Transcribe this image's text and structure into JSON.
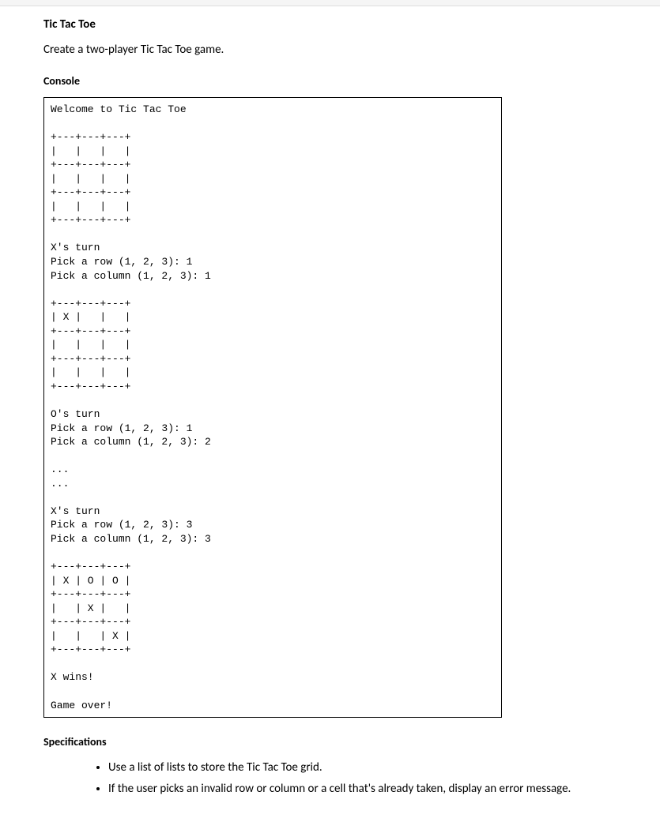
{
  "title": "Tic Tac Toe",
  "description": "Create a two-player Tic Tac Toe game.",
  "console_heading": "Console",
  "console_output": "Welcome to Tic Tac Toe\n\n+---+---+---+\n|   |   |   |\n+---+---+---+\n|   |   |   |\n+---+---+---+\n|   |   |   |\n+---+---+---+\n\nX's turn\nPick a row (1, 2, 3): 1\nPick a column (1, 2, 3): 1\n\n+---+---+---+\n| X |   |   |\n+---+---+---+\n|   |   |   |\n+---+---+---+\n|   |   |   |\n+---+---+---+\n\nO's turn\nPick a row (1, 2, 3): 1\nPick a column (1, 2, 3): 2\n\n...\n...\n\nX's turn\nPick a row (1, 2, 3): 3\nPick a column (1, 2, 3): 3\n\n+---+---+---+\n| X | O | O |\n+---+---+---+\n|   | X |   |\n+---+---+---+\n|   |   | X |\n+---+---+---+\n\nX wins!\n\nGame over!",
  "specs_heading": "Specifications",
  "specs": {
    "items": [
      "Use a list of lists to store the Tic Tac Toe grid.",
      "If the user picks an invalid row or column or a cell that's already taken, display an error message."
    ]
  }
}
